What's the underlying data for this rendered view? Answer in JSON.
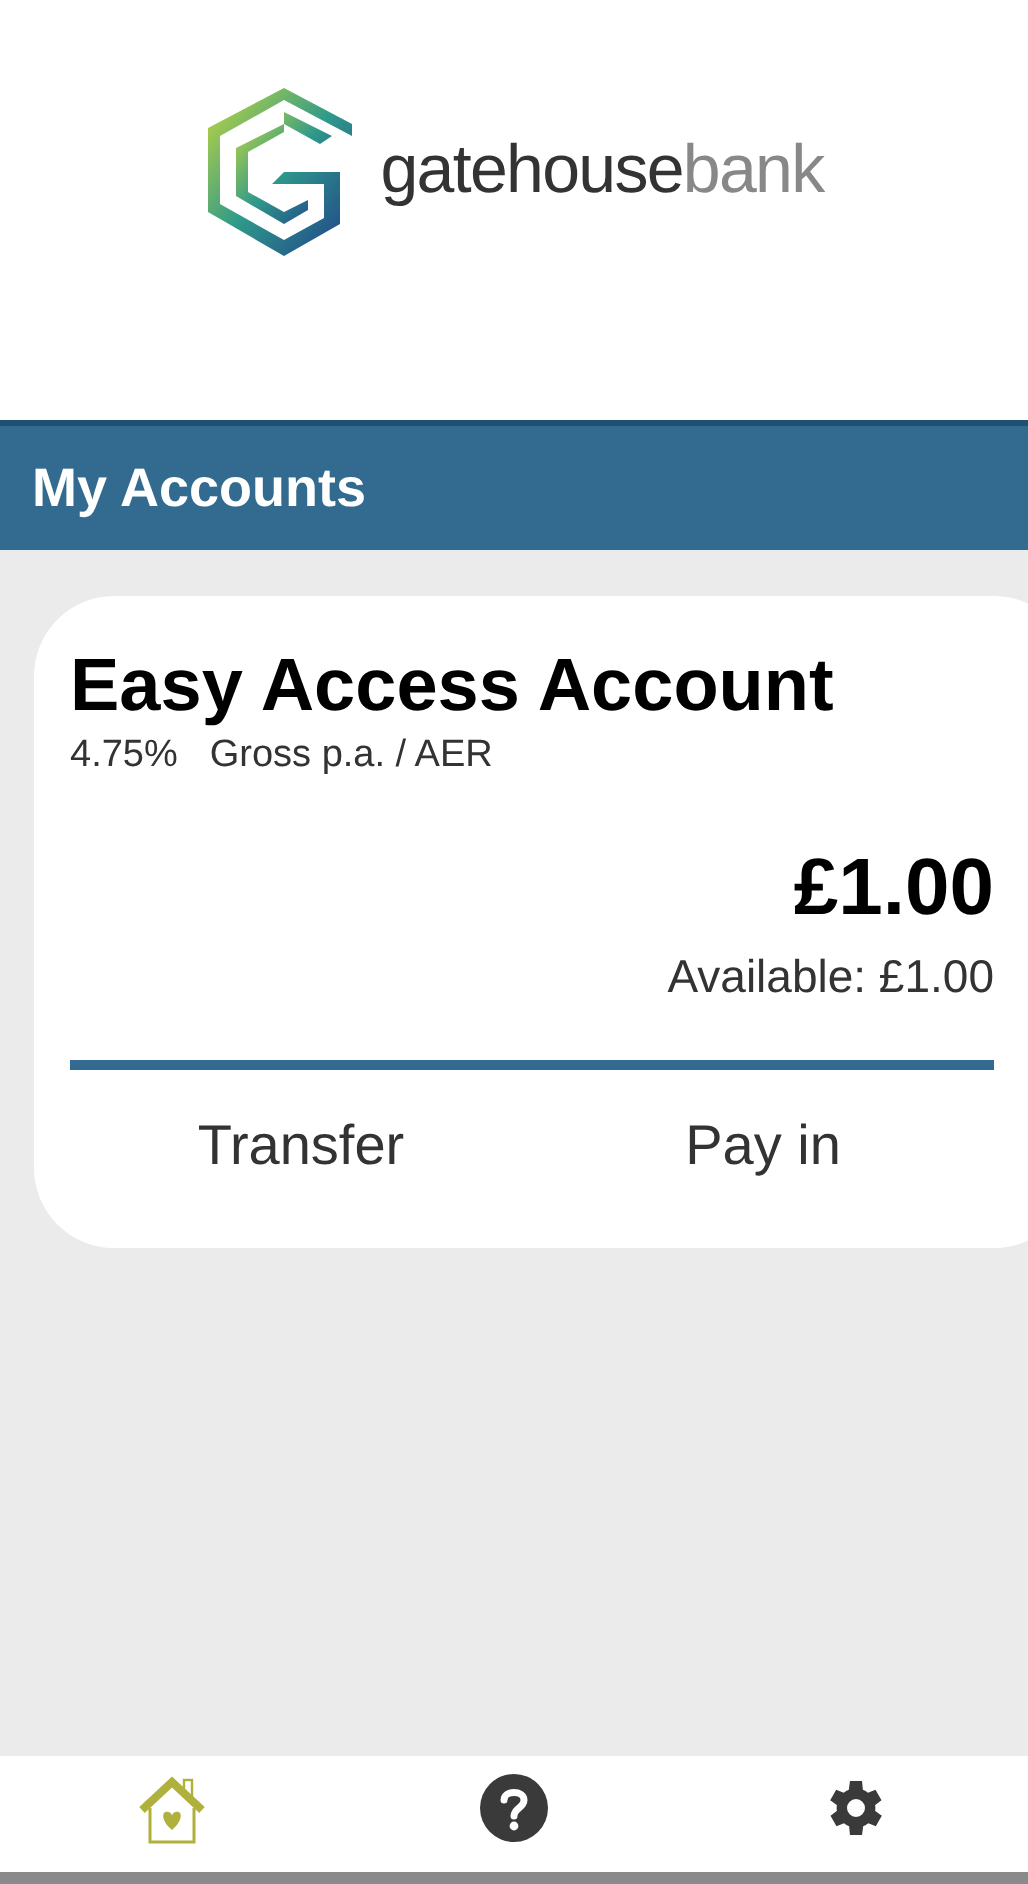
{
  "logo": {
    "word": "gatehouse",
    "suffix": "bank"
  },
  "header": {
    "title": "My Accounts"
  },
  "accounts": [
    {
      "name": "Easy Access Account",
      "rate": "4.75%",
      "rate_label": "Gross p.a. / AER",
      "balance": "£1.00",
      "available": "Available: £1.00",
      "actions": [
        "Transfer",
        "Pay in"
      ]
    }
  ],
  "nav": [
    {
      "kind": "home",
      "selected": true
    },
    {
      "kind": "help",
      "selected": false
    },
    {
      "kind": "settings",
      "selected": false
    }
  ]
}
